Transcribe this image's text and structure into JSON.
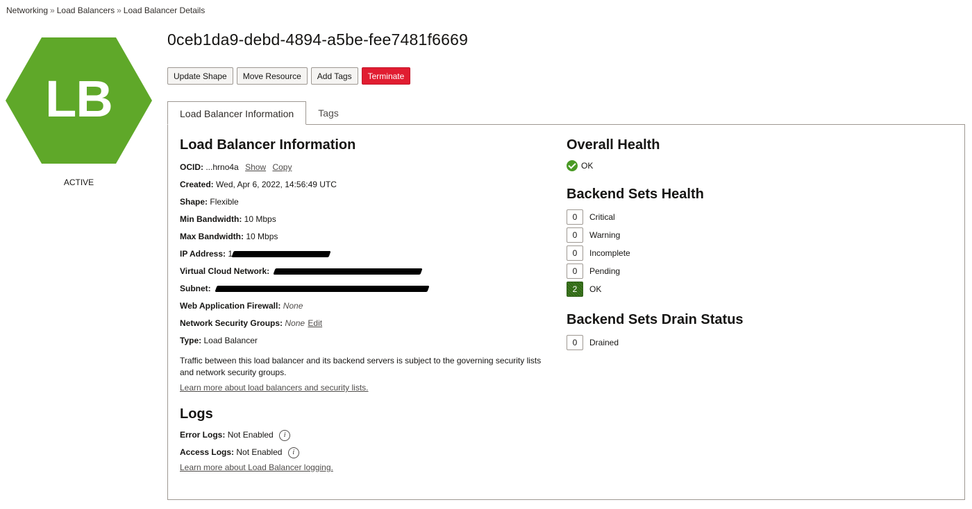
{
  "breadcrumb": {
    "items": [
      "Networking",
      "Load Balancers",
      "Load Balancer Details"
    ],
    "separator": "»"
  },
  "resource": {
    "icon_text": "LB",
    "state": "ACTIVE",
    "title": "0ceb1da9-debd-4894-a5be-fee7481f6669",
    "icon_color": "#5fa829"
  },
  "actions": {
    "update_shape": "Update Shape",
    "move_resource": "Move Resource",
    "add_tags": "Add Tags",
    "terminate": "Terminate"
  },
  "tabs": [
    {
      "label": "Load Balancer Information",
      "active": true
    },
    {
      "label": "Tags",
      "active": false
    }
  ],
  "info": {
    "heading": "Load Balancer Information",
    "ocid_label": "OCID:",
    "ocid_value": "...hrno4a",
    "show": "Show",
    "copy": "Copy",
    "created_label": "Created:",
    "created_value": "Wed, Apr 6, 2022, 14:56:49 UTC",
    "shape_label": "Shape:",
    "shape_value": "Flexible",
    "min_bw_label": "Min Bandwidth:",
    "min_bw_value": "10 Mbps",
    "max_bw_label": "Max Bandwidth:",
    "max_bw_value": "10 Mbps",
    "ip_label": "IP Address:",
    "ip_value": "1",
    "vcn_label": "Virtual Cloud Network:",
    "subnet_label": "Subnet:",
    "waf_label": "Web Application Firewall:",
    "waf_value": "None",
    "nsg_label": "Network Security Groups:",
    "nsg_value": "None",
    "nsg_edit": "Edit",
    "type_label": "Type:",
    "type_value": "Load Balancer",
    "paragraph": "Traffic between this load balancer and its backend servers is subject to the governing security lists and network security groups.",
    "learn_more": "Learn more about load balancers and security lists."
  },
  "logs": {
    "heading": "Logs",
    "error_label": "Error Logs:",
    "error_value": "Not Enabled",
    "access_label": "Access Logs:",
    "access_value": "Not Enabled",
    "learn_more": "Learn more about Load Balancer logging.",
    "info_glyph": "i"
  },
  "health": {
    "overall_heading": "Overall Health",
    "overall_value": "OK",
    "backend_heading": "Backend Sets Health",
    "backend_items": [
      {
        "count": "0",
        "label": "Critical"
      },
      {
        "count": "0",
        "label": "Warning"
      },
      {
        "count": "0",
        "label": "Incomplete"
      },
      {
        "count": "0",
        "label": "Pending"
      },
      {
        "count": "2",
        "label": "OK"
      }
    ],
    "drain_heading": "Backend Sets Drain Status",
    "drain_items": [
      {
        "count": "0",
        "label": "Drained"
      }
    ]
  }
}
